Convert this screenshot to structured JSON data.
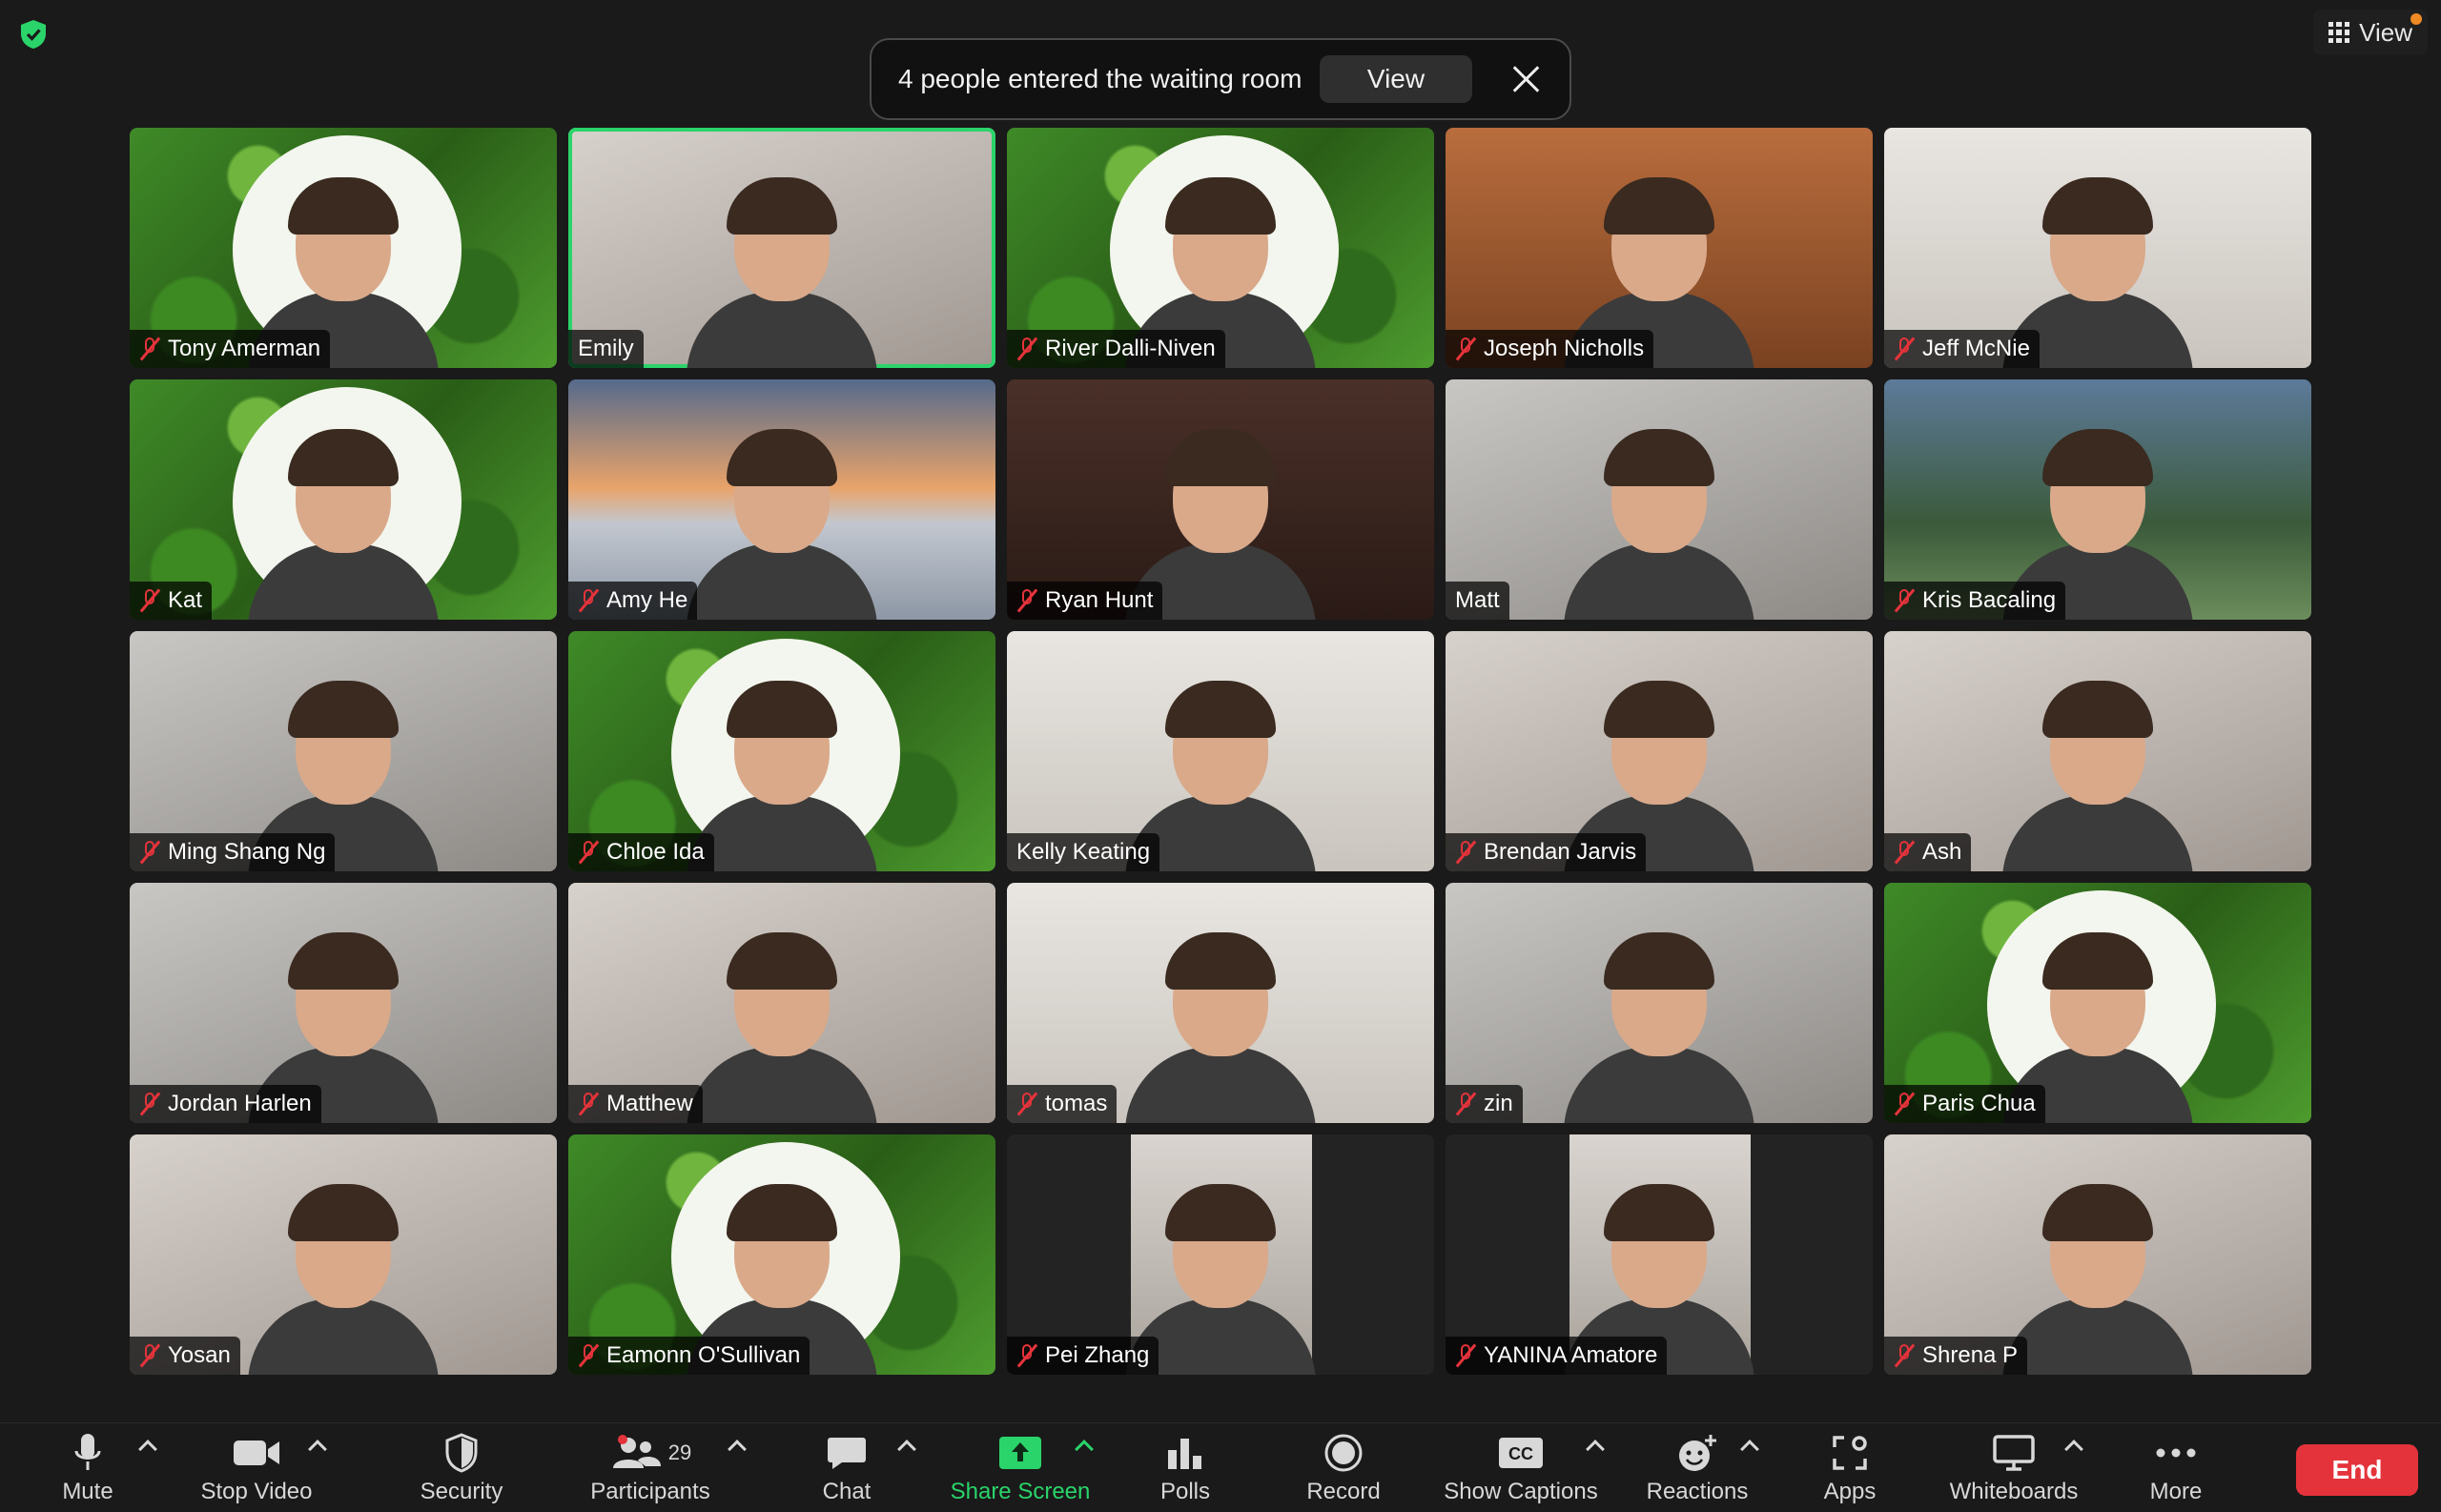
{
  "banner": {
    "message": "4 people entered the waiting room",
    "view_label": "View"
  },
  "top": {
    "view_label": "View"
  },
  "participants": [
    {
      "name": "Tony Amerman",
      "muted": true
    },
    {
      "name": "Emily",
      "muted": false,
      "active": true
    },
    {
      "name": "River Dalli-Niven",
      "muted": true
    },
    {
      "name": "Joseph Nicholls",
      "muted": true
    },
    {
      "name": "Jeff McNie",
      "muted": true
    },
    {
      "name": "Kat",
      "muted": true
    },
    {
      "name": "Amy He",
      "muted": true
    },
    {
      "name": "Ryan Hunt",
      "muted": true
    },
    {
      "name": "Matt",
      "muted": false
    },
    {
      "name": "Kris Bacaling",
      "muted": true
    },
    {
      "name": "Ming Shang Ng",
      "muted": true
    },
    {
      "name": "Chloe Ida",
      "muted": true
    },
    {
      "name": "Kelly Keating",
      "muted": false
    },
    {
      "name": "Brendan Jarvis",
      "muted": true
    },
    {
      "name": "Ash",
      "muted": true
    },
    {
      "name": "Jordan Harlen",
      "muted": true
    },
    {
      "name": "Matthew",
      "muted": true
    },
    {
      "name": "tomas",
      "muted": true
    },
    {
      "name": "zin",
      "muted": true
    },
    {
      "name": "Paris Chua",
      "muted": true
    },
    {
      "name": "Yosan",
      "muted": true
    },
    {
      "name": "Eamonn O'Sullivan",
      "muted": true
    },
    {
      "name": "Pei Zhang",
      "muted": true
    },
    {
      "name": "YANINA Amatore",
      "muted": true
    },
    {
      "name": "Shrena P",
      "muted": true
    }
  ],
  "toolbar": {
    "mute": "Mute",
    "stop_video": "Stop Video",
    "security": "Security",
    "participants": "Participants",
    "participants_count": "29",
    "chat": "Chat",
    "share_screen": "Share Screen",
    "polls": "Polls",
    "record": "Record",
    "show_captions": "Show Captions",
    "captions_badge": "CC",
    "reactions": "Reactions",
    "apps": "Apps",
    "whiteboards": "Whiteboards",
    "more": "More",
    "end": "End"
  },
  "colors": {
    "accent_green": "#2ad46a",
    "end_red": "#e5333b",
    "muted_red": "#e5333b"
  }
}
